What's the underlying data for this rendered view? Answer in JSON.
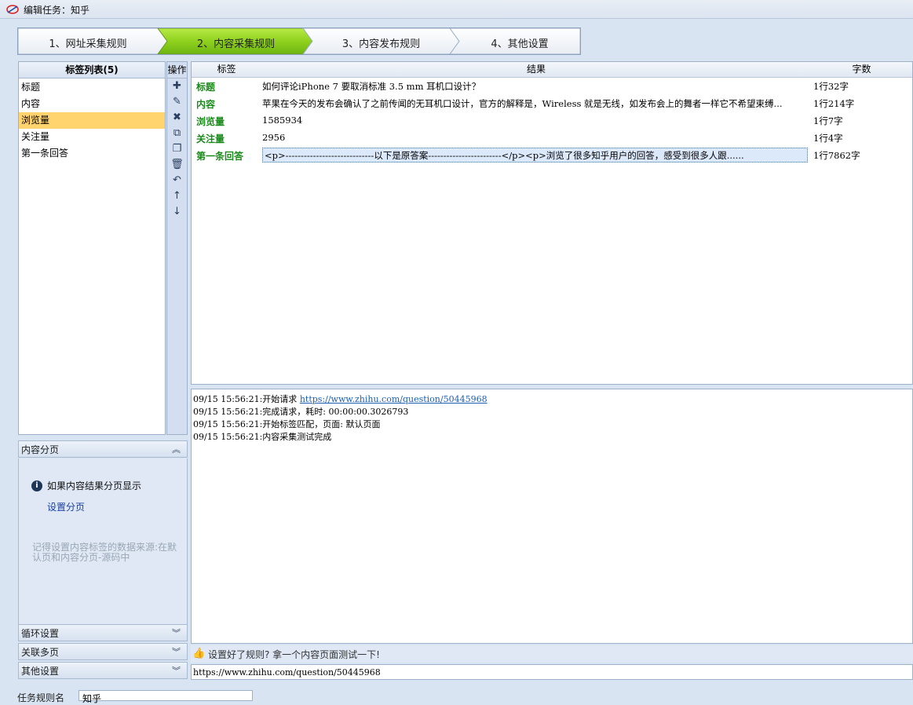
{
  "window": {
    "title": "编辑任务：知乎"
  },
  "steps": [
    {
      "label": "1、网址采集规则",
      "active": false
    },
    {
      "label": "2、内容采集规则",
      "active": true
    },
    {
      "label": "3、内容发布规则",
      "active": false
    },
    {
      "label": "4、其他设置",
      "active": false
    }
  ],
  "tag_list": {
    "header": "标签列表(5)",
    "items": [
      "标题",
      "内容",
      "浏览量",
      "关注量",
      "第一条回答"
    ],
    "selected": "浏览量"
  },
  "ops": {
    "header": "操作",
    "icons": [
      "add-icon",
      "edit-icon",
      "delete-icon",
      "copy-icon",
      "paste-icon",
      "trash-icon",
      "undo-icon",
      "move-up-icon",
      "move-down-icon"
    ],
    "glyphs": [
      "✚",
      "✎",
      "✖",
      "⧉",
      "❐",
      "🗑",
      "↶",
      "↑",
      "↓"
    ]
  },
  "accordion": {
    "content_paging": "内容分页",
    "info_text": "如果内容结果分页显示",
    "setup_link": "设置分页",
    "hint": "记得设置内容标签的数据来源:在默认页和内容分页-源码中",
    "loop": "循环设置",
    "multi_page": "关联多页",
    "other": "其他设置"
  },
  "grid": {
    "columns": [
      "标签",
      "结果",
      "字数"
    ],
    "rows": [
      {
        "tag": "标题",
        "result": "如何评论iPhone 7 要取消标准 3.5 mm 耳机口设计？",
        "count": "1行32字"
      },
      {
        "tag": "内容",
        "result": "苹果在今天的发布会确认了之前传闻的无耳机口设计，官方的解释是，Wireless 就是无线，如发布会上的舞者一样它不希望束缚...",
        "count": "1行214字"
      },
      {
        "tag": "浏览量",
        "result": "1585934",
        "count": "1行7字"
      },
      {
        "tag": "关注量",
        "result": "2956",
        "count": "1行4字"
      },
      {
        "tag": "第一条回答",
        "result": "<p>-----------------------------以下是原答案------------------------</p><p>浏览了很多知乎用户的回答，感受到很多人跟......",
        "count": "1行7862字"
      }
    ]
  },
  "log": {
    "lines": [
      {
        "prefix": "09/15 15:56:21:开始请求 ",
        "link": "https://www.zhihu.com/question/50445968"
      },
      {
        "prefix": "09/15 15:56:21:完成请求，耗时: 00:00:00.3026793",
        "link": ""
      },
      {
        "prefix": "09/15 15:56:21:开始标签匹配，页面: 默认页面",
        "link": ""
      },
      {
        "prefix": "09/15 15:56:21:内容采集测试完成",
        "link": ""
      }
    ]
  },
  "test": {
    "hint": "设置好了规则? 拿一个内容页面测试一下!",
    "url": "https://www.zhihu.com/question/50445968"
  },
  "bottom": {
    "label": "任务规则名",
    "value": "知乎"
  },
  "colors": {
    "active_step": "#8fd11e",
    "selected_tag": "#ffd36e",
    "tag_text": "#1a8a1a"
  }
}
